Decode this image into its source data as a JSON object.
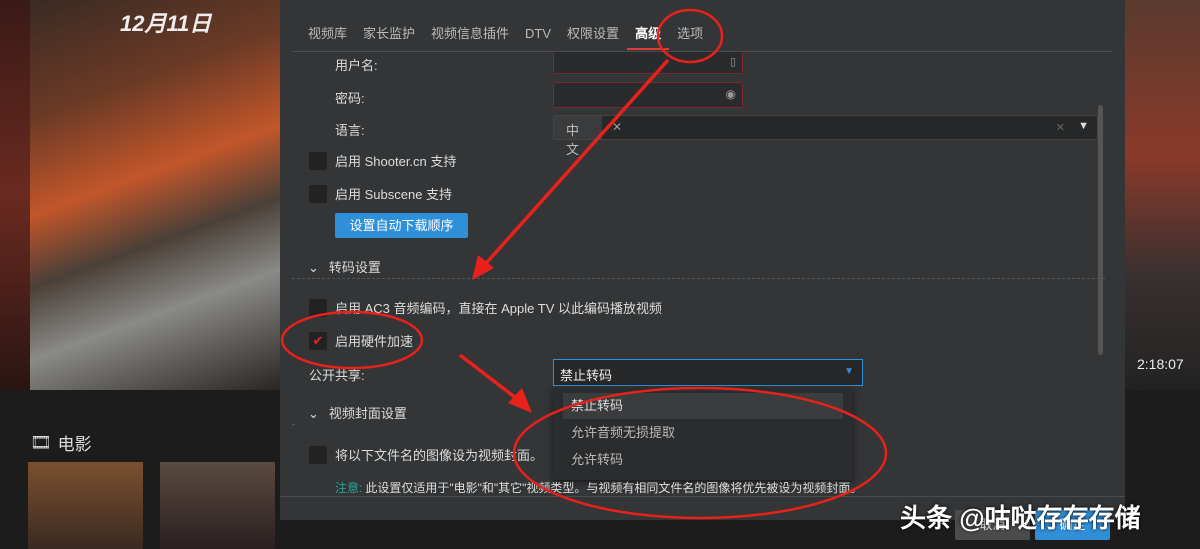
{
  "background": {
    "poster_title": "12月11日",
    "duration": "2:18:07",
    "section_title": "电影"
  },
  "tabs": [
    {
      "label": "视频库"
    },
    {
      "label": "家长监护"
    },
    {
      "label": "视频信息插件"
    },
    {
      "label": "DTV"
    },
    {
      "label": "权限设置"
    },
    {
      "label": "高级",
      "active": true
    },
    {
      "label": "选项"
    }
  ],
  "form": {
    "username_label": "用户名:",
    "password_label": "密码:",
    "language_label": "语言:",
    "language_tag": "中文",
    "shooter": "启用 Shooter.cn 支持",
    "subscene": "启用 Subscene 支持",
    "download_order_button": "设置自动下载顺序",
    "transcode_section": "转码设置",
    "ac3": "启用 AC3 音频编码，直接在 Apple TV 以此编码播放视频",
    "hw_accel": "启用硬件加速",
    "hw_accel_checked": true,
    "public_share_label": "公开共享:",
    "public_share_value": "禁止转码",
    "public_share_options": [
      "禁止转码",
      "允许音频无损提取",
      "允许转码"
    ],
    "cover_section": "视频封面设置",
    "cover_cb": "将以下文件名的图像设为视频封面。",
    "note_label": "注意:",
    "note_text": "此设置仅适用于\"电影\"和\"其它\"视频类型。与视频有相同文件名的图像将优先被设为视频封面。"
  },
  "footer": {
    "cancel": "取消",
    "ok": "确定"
  },
  "watermark": "头条 @咕哒存存存储",
  "colors": {
    "accent": "#2f8fd8",
    "annotation": "#e8221b",
    "dialog_bg": "#333537"
  }
}
